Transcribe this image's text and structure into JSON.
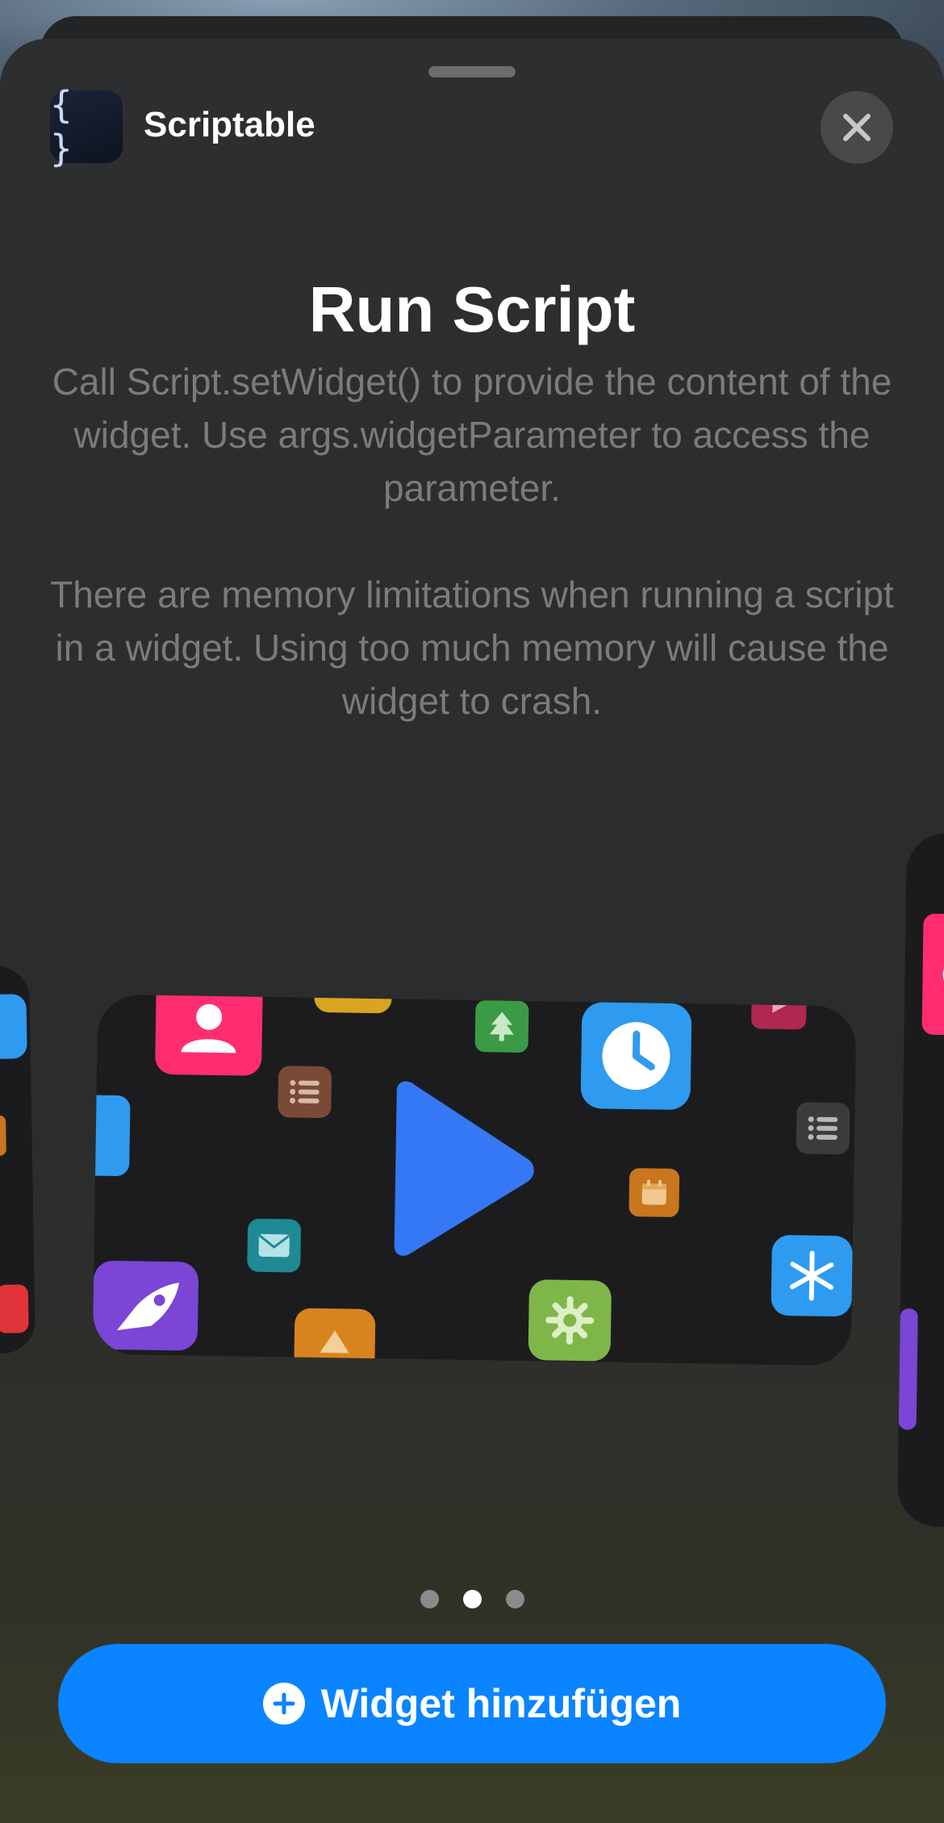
{
  "app": {
    "name": "Scriptable",
    "icon_glyph": "{ }"
  },
  "widget_info": {
    "title": "Run Script",
    "paragraphs": [
      "Call Script.setWidget() to provide the content of the widget. Use args.widgetParameter to access the parameter.",
      "There are memory limitations when running a script in a widget. Using too much memory will cause the widget to crash."
    ]
  },
  "preview": {
    "icons": [
      "person-icon",
      "tree-icon",
      "clock-icon",
      "play-icon",
      "list-icon",
      "snowflake-icon",
      "calendar-icon",
      "mail-icon",
      "rocket-icon",
      "gear-icon",
      "warning-icon"
    ],
    "colors": {
      "play": "#3478f6",
      "pink": "#ff2d6f",
      "blue": "#2e9bf0",
      "green": "#3b9a46",
      "brown": "#7a4a36",
      "orange": "#c9761e",
      "teal": "#1f8a94",
      "purple": "#7b45d6",
      "lime": "#7fb64a"
    }
  },
  "pagination": {
    "pages": 3,
    "current": 2
  },
  "add_button": {
    "label": "Widget hinzufügen",
    "color": "#0a84ff"
  }
}
